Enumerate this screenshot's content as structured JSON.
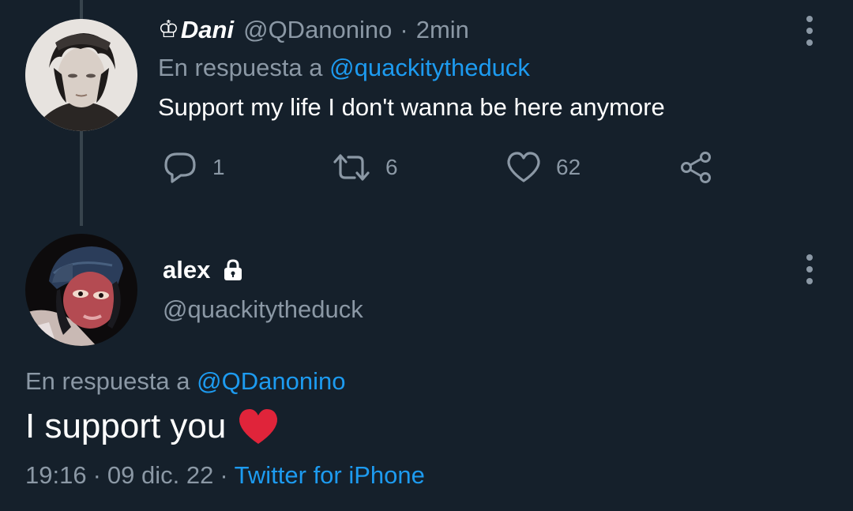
{
  "tweet_parent": {
    "display_name": "Dani",
    "display_name_prefix_icon": "chess-king-icon",
    "handle": "@QDanonino",
    "separator": "·",
    "time_ago": "2min",
    "reply_prefix": "En respuesta a",
    "reply_to": "@quackitytheduck",
    "text": "Support my life I don't wanna be here anymore",
    "actions": {
      "reply_count": "1",
      "retweet_count": "6",
      "like_count": "62"
    }
  },
  "tweet_main": {
    "display_name": "alex",
    "protected_icon": "lock-icon",
    "handle": "@quackitytheduck",
    "reply_prefix": "En respuesta a",
    "reply_to": "@QDanonino",
    "text": "I support you",
    "emoji": "red-heart-icon",
    "time": "19:16",
    "separator": "·",
    "date": "09 dic. 22",
    "source": "Twitter for iPhone"
  },
  "colors": {
    "background": "#15202b",
    "text_primary": "#ffffff",
    "text_secondary": "#8b98a5",
    "accent": "#1d9bf0",
    "heart": "#e0243a",
    "thread_line": "#38444d"
  }
}
